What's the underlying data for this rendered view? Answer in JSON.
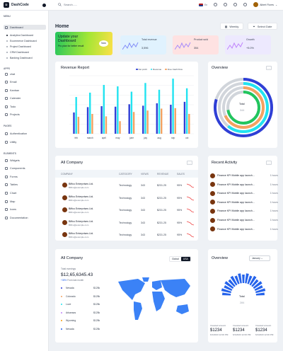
{
  "app": {
    "name": "DashCode",
    "search_placeholder": "Search......",
    "lang": "En",
    "user": "Albert Flores"
  },
  "sidebar": {
    "menu_heading": "MENU",
    "dashboard": "Dashboard",
    "dashboards": [
      "Analytics Dashboard",
      "Ecommerce Dashboard",
      "Project Dashboard",
      "CRM Dashboard",
      "Banking Dashboard"
    ],
    "apps_heading": "APPS",
    "apps": [
      "chat",
      "Email",
      "Kanban",
      "Calender",
      "Todo",
      "Projects"
    ],
    "pages_heading": "PAGES",
    "pages": [
      "Authentication",
      "Utility"
    ],
    "elements_heading": "ELEMENTS",
    "elements": [
      "Widgets",
      "Components",
      "Forms",
      "Tables",
      "Chart",
      "Map",
      "Icons",
      "Documentation"
    ]
  },
  "page": {
    "title": "Home",
    "weekly": "Weekly",
    "select_date": "Select Date"
  },
  "promo": {
    "title": "Update your Dashboard",
    "subtitle": "Pro plan for better result",
    "button": "Now"
  },
  "stats": [
    {
      "label": "Total revenue",
      "value": "3,596",
      "bg": "#e0f2fe",
      "line": "#818cf8"
    },
    {
      "label": "Product sold",
      "value": "354",
      "bg": "#fee2e2",
      "line": "#a78bfa"
    },
    {
      "label": "Growth",
      "value": "+5.0%",
      "bg": "#ede9fe",
      "line": "#c084fc"
    }
  ],
  "revenue": {
    "title": "Revenue Report",
    "legend": [
      {
        "name": "Net profit",
        "color": "#2f3fd6"
      },
      {
        "name": "Revenue",
        "color": "#22e3f0"
      },
      {
        "name": "Free Cash Flow",
        "color": "#f4a261"
      }
    ]
  },
  "chart_data": {
    "type": "bar",
    "title": "Revenue Report",
    "categories": [
      "feb",
      "march",
      "april",
      "may",
      "june",
      "july",
      "aug",
      "sep",
      "oct"
    ],
    "series": [
      {
        "name": "Net profit",
        "values": [
          44,
          55,
          57,
          56,
          61,
          58,
          63,
          60,
          66
        ]
      },
      {
        "name": "Revenue",
        "values": [
          76,
          85,
          101,
          98,
          87,
          105,
          91,
          114,
          94
        ]
      },
      {
        "name": "Free Cash Flow",
        "values": [
          35,
          41,
          36,
          26,
          45,
          48,
          52,
          53,
          41
        ]
      }
    ],
    "ylim": [
      0,
      120
    ],
    "grid": true,
    "legend": "top-right"
  },
  "overview": {
    "title": "Overview",
    "total_label": "Total",
    "total_value": "344"
  },
  "all_company": {
    "title": "All Company",
    "columns": [
      "COMPANY",
      "CATEGORY",
      "VIEWS",
      "REVENUE",
      "SALES"
    ],
    "rows": [
      {
        "name": "Biffco Enterprises Ltd.",
        "email": "Biffco@example.com",
        "category": "Technology",
        "views": "343",
        "revenue": "$231.25",
        "sales": "95%"
      },
      {
        "name": "Biffco Enterprises Ltd.",
        "email": "Biffco@example.com",
        "category": "Technology",
        "views": "343",
        "revenue": "$231.25",
        "sales": "95%"
      },
      {
        "name": "Biffco Enterprises Ltd.",
        "email": "Biffco@example.com",
        "category": "Technology",
        "views": "343",
        "revenue": "$231.25",
        "sales": "95%"
      },
      {
        "name": "Biffco Enterprises Ltd.",
        "email": "Biffco@example.com",
        "category": "Technology",
        "views": "343",
        "revenue": "$231.25",
        "sales": "95%"
      },
      {
        "name": "Biffco Enterprises Ltd.",
        "email": "Biffco@example.com",
        "category": "Technology",
        "views": "343",
        "revenue": "$231.25",
        "sales": "95%"
      }
    ]
  },
  "activity": {
    "title": "Recent Activity",
    "items": [
      {
        "text": "Finance KPI Mobile app launch...",
        "time": "1 hours"
      },
      {
        "text": "Finance KPI Mobile app launch...",
        "time": "1 hours"
      },
      {
        "text": "Finance KPI Mobile app launch...",
        "time": "1 hours"
      },
      {
        "text": "Finance KPI Mobile app launch...",
        "time": "1 hours"
      },
      {
        "text": "Finance KPI Mobile app launch...",
        "time": "1 hours"
      },
      {
        "text": "Finance KPI Mobile app launch...",
        "time": "1 hours"
      },
      {
        "text": "Finance KPI Mobile app launch...",
        "time": "1 hours"
      }
    ]
  },
  "earnings": {
    "title": "All Company",
    "toggle": [
      "Global",
      "USA"
    ],
    "label": "Total earnings",
    "value": "$12,65,6345.43",
    "change": "+08%",
    "change_note": "From last month",
    "states": [
      {
        "name": "Nevada",
        "value": "$125k",
        "color": "#2f3fd6"
      },
      {
        "name": "Colorado",
        "value": "$125k",
        "color": "#f4a261"
      },
      {
        "name": "Love",
        "value": "$125k",
        "color": "#22e3f0"
      },
      {
        "name": "Arkansas",
        "value": "$125k",
        "color": "#c084fc"
      },
      {
        "name": "Wyoming",
        "value": "$125k",
        "color": "#f59e0b"
      },
      {
        "name": "Nevada",
        "value": "$125k",
        "color": "#2563eb"
      }
    ]
  },
  "overview2": {
    "title": "Overview",
    "select": "January",
    "total_label": "Total",
    "total_value": "284",
    "invested": [
      {
        "label": "Invested amount",
        "value": "$1234",
        "date": "6/1/2023 12:00 PM"
      },
      {
        "label": "Invested amount",
        "value": "$1234",
        "date": "6/1/2023 12:00 PM"
      },
      {
        "label": "Invested amount",
        "value": "$1234",
        "date": "6/1/2023 12:00 PM"
      }
    ]
  }
}
